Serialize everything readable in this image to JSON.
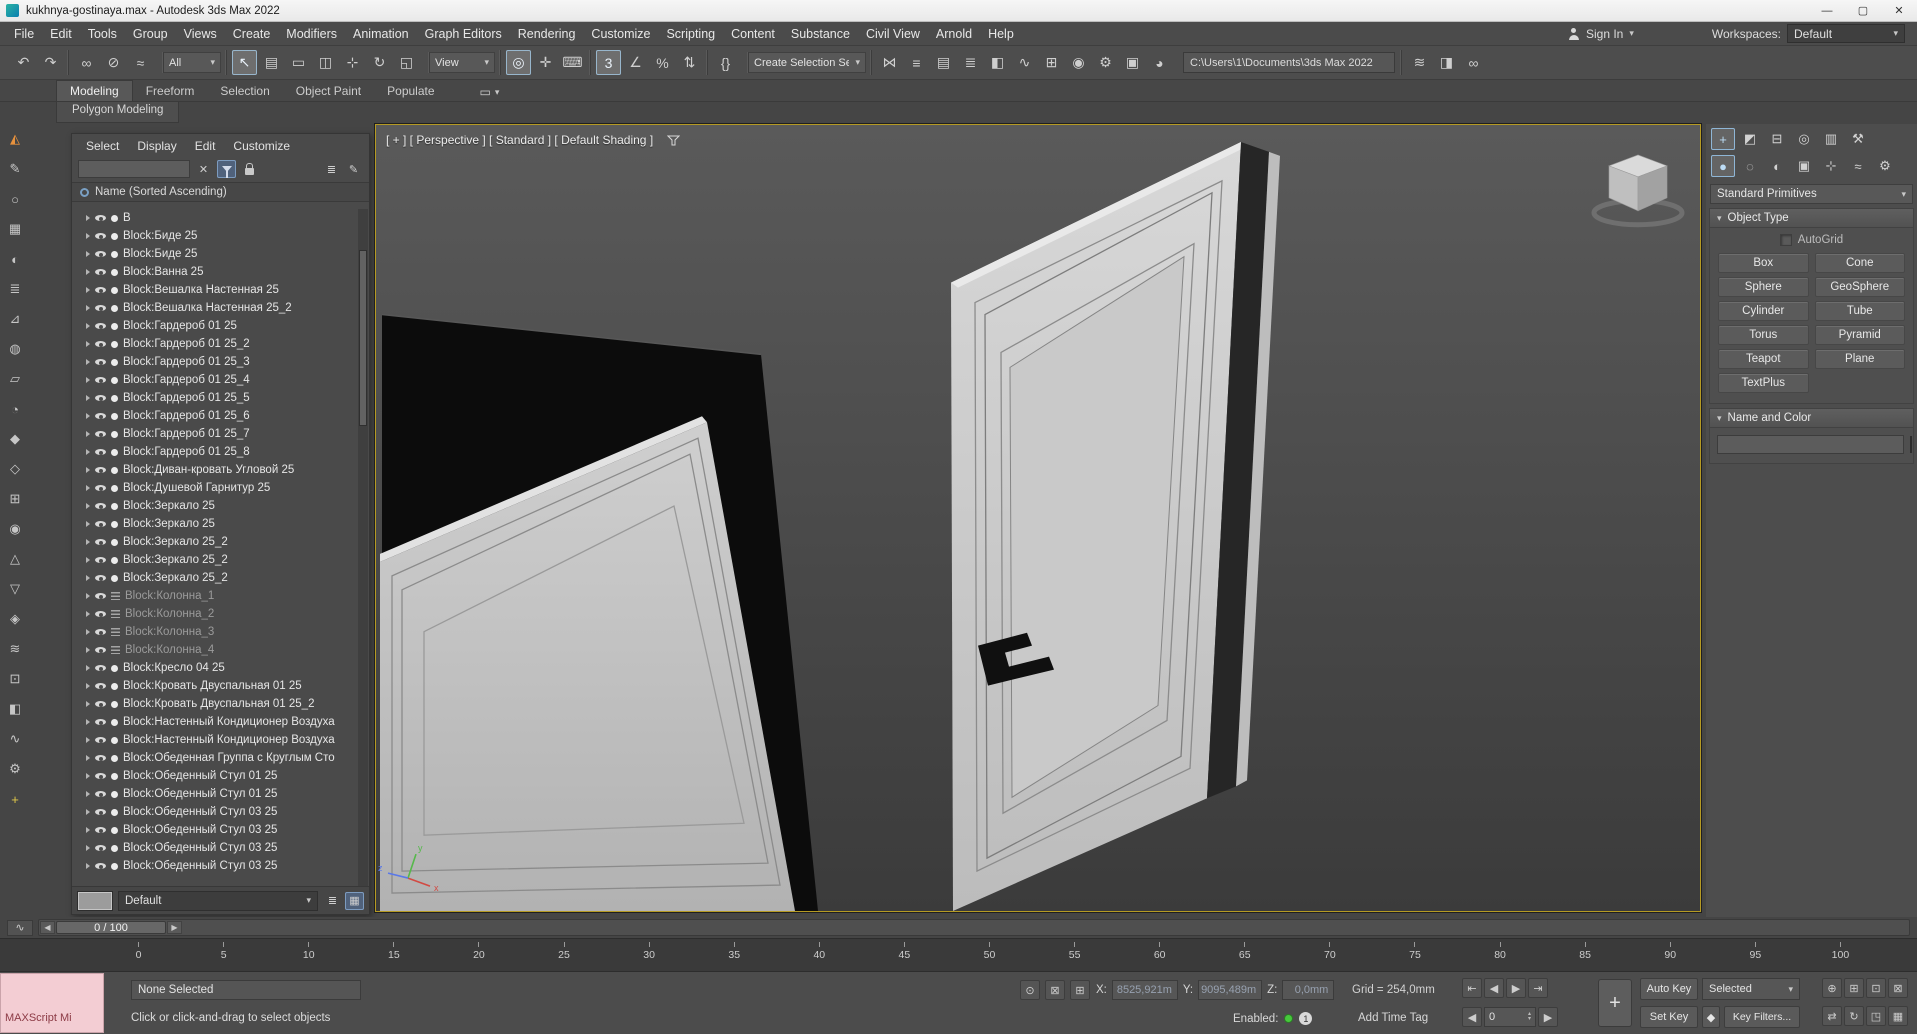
{
  "ui": {
    "caret": "▾",
    "rollout_arrow": "▾",
    "minimize": "—",
    "maximize": "▢",
    "close": "✕",
    "clear": "✕",
    "slider_left": "◀",
    "slider_right": "▶",
    "spinner_up": "▴",
    "spinner_down": "▾",
    "plus": "+",
    "mini_curve": "∿"
  },
  "title_bar": {
    "title": "kukhnya-gostinaya.max - Autodesk 3ds Max 2022"
  },
  "menu_bar": {
    "items": [
      "File",
      "Edit",
      "Tools",
      "Group",
      "Views",
      "Create",
      "Modifiers",
      "Animation",
      "Graph Editors",
      "Rendering",
      "Customize",
      "Scripting",
      "Content",
      "Substance",
      "Civil View",
      "Arnold",
      "Help"
    ],
    "sign_in": "Sign In",
    "workspaces_label": "Workspaces:",
    "workspace_value": "Default"
  },
  "toolbar": {
    "groups_a": [
      {
        "name": "undo-icon",
        "glyph": "↶"
      },
      {
        "name": "redo-icon",
        "glyph": "↷"
      }
    ],
    "groups_b": [
      {
        "name": "select-and-link-icon",
        "glyph": "∞"
      },
      {
        "name": "unlink-selection-icon",
        "glyph": "⊘"
      },
      {
        "name": "bind-to-space-warp-icon",
        "glyph": "≈"
      }
    ],
    "selection_filter_value": "All",
    "groups_c": [
      {
        "name": "select-object-icon",
        "glyph": "↖",
        "active": true
      },
      {
        "name": "select-by-name-icon",
        "glyph": "▤"
      },
      {
        "name": "rectangular-selection-icon",
        "glyph": "▭"
      },
      {
        "name": "crossing-selection-icon",
        "glyph": "◫"
      },
      {
        "name": "select-and-move-icon",
        "glyph": "⊹"
      },
      {
        "name": "select-and-rotate-icon",
        "glyph": "↻"
      },
      {
        "name": "select-and-scale-icon",
        "glyph": "◱"
      }
    ],
    "reference_coordinate_value": "View",
    "groups_d": [
      {
        "name": "use-pivot-point-icon",
        "glyph": "◎",
        "active": true
      },
      {
        "name": "select-and-manipulate-icon",
        "glyph": "✛"
      },
      {
        "name": "keyboard-override-icon",
        "glyph": "⌨"
      }
    ],
    "groups_e": [
      {
        "name": "snaps-toggle-icon",
        "glyph": "3",
        "active": true
      },
      {
        "name": "angle-snap-icon",
        "glyph": "∠"
      },
      {
        "name": "percent-snap-icon",
        "glyph": "%"
      },
      {
        "name": "spinner-snap-icon",
        "glyph": "⇅"
      }
    ],
    "groups_f": [
      {
        "name": "edit-named-selection-sets-icon",
        "glyph": "{}"
      }
    ],
    "named_selection_value": "Create Selection Se",
    "groups_g": [
      {
        "name": "mirror-icon",
        "glyph": "⋈"
      },
      {
        "name": "align-icon",
        "glyph": "≡"
      },
      {
        "name": "toggle-scene-explorer-icon",
        "glyph": "▤"
      },
      {
        "name": "toggle-layer-explorer-icon",
        "glyph": "≣"
      },
      {
        "name": "graphite-ribbon-icon",
        "glyph": "◧"
      },
      {
        "name": "curve-editor-icon",
        "glyph": "∿"
      },
      {
        "name": "schematic-view-icon",
        "glyph": "⊞"
      },
      {
        "name": "material-editor-icon",
        "glyph": "◉"
      },
      {
        "name": "render-setup-icon",
        "glyph": "⚙"
      },
      {
        "name": "rendered-frame-icon",
        "glyph": "▣"
      },
      {
        "name": "render-production-icon",
        "glyph": "◕"
      }
    ],
    "project_path": "C:\\Users\\1\\Documents\\3ds Max 2022",
    "groups_h": [
      {
        "name": "layer-explorer-icon",
        "glyph": "≋"
      },
      {
        "name": "container-explorer-icon",
        "glyph": "◨"
      },
      {
        "name": "manage-links-icon",
        "glyph": "∞"
      }
    ]
  },
  "ribbon": {
    "tabs": [
      {
        "label": "Modeling",
        "active": true
      },
      {
        "label": "Freeform"
      },
      {
        "label": "Selection"
      },
      {
        "label": "Object Paint"
      },
      {
        "label": "Populate"
      }
    ],
    "flyout_glyph": "▭",
    "panel_label": "Polygon Modeling"
  },
  "left_strip": {
    "icons": [
      {
        "name": "ribbon-modeling-icon",
        "glyph": "◭",
        "orange": true
      },
      {
        "name": "freeform-paint-icon",
        "glyph": "✎"
      },
      {
        "name": "spline-tool-icon",
        "glyph": "○"
      },
      {
        "name": "grid-tool-icon",
        "glyph": "▦"
      },
      {
        "name": "shading-tool-icon",
        "glyph": "◐"
      },
      {
        "name": "list-tool-icon",
        "glyph": "≣"
      },
      {
        "name": "cut-tool-icon",
        "glyph": "⊿"
      },
      {
        "name": "texture-tool-icon",
        "glyph": "◍"
      },
      {
        "name": "plane-tool-icon",
        "glyph": "▱"
      },
      {
        "name": "arc-tool-icon",
        "glyph": "◔"
      },
      {
        "name": "diamond-tool-icon",
        "glyph": "◆"
      },
      {
        "name": "outline-tool-icon",
        "glyph": "◇"
      },
      {
        "name": "boolean-tool-icon",
        "glyph": "⊞"
      },
      {
        "name": "sphere-tool-icon",
        "glyph": "◉"
      },
      {
        "name": "tri-up-tool-icon",
        "glyph": "△"
      },
      {
        "name": "tri-down-tool-icon",
        "glyph": "▽"
      },
      {
        "name": "gem-tool-icon",
        "glyph": "◈"
      },
      {
        "name": "waves-tool-icon",
        "glyph": "≋"
      },
      {
        "name": "target-tool-icon",
        "glyph": "⊡"
      },
      {
        "name": "half-square-tool-icon",
        "glyph": "◧"
      },
      {
        "name": "curve-tool-icon",
        "glyph": "∿"
      },
      {
        "name": "settings-tool-icon",
        "glyph": "⚙"
      },
      {
        "name": "add-tool-icon",
        "glyph": "+",
        "yellow": true
      }
    ]
  },
  "scene_explorer": {
    "menus": [
      "Select",
      "Display",
      "Edit",
      "Customize"
    ],
    "column_header": "Name (Sorted Ascending)",
    "tool_icons": [
      {
        "name": "pick-list-icon",
        "glyph": "≣"
      },
      {
        "name": "edit-columns-icon",
        "glyph": "✎"
      }
    ],
    "footer_icons": [
      {
        "name": "layers-icon",
        "glyph": "≣"
      },
      {
        "name": "grid-view-icon",
        "glyph": "▦",
        "active": true
      }
    ],
    "layer_value": "Default",
    "items": [
      {
        "label": "B"
      },
      {
        "label": "Block:Биде 25"
      },
      {
        "label": "Block:Биде 25"
      },
      {
        "label": "Block:Ванна 25"
      },
      {
        "label": "Block:Вешалка Настенная 25"
      },
      {
        "label": "Block:Вешалка Настенная 25_2"
      },
      {
        "label": "Block:Гардероб 01 25"
      },
      {
        "label": "Block:Гардероб 01 25_2"
      },
      {
        "label": "Block:Гардероб 01 25_3"
      },
      {
        "label": "Block:Гардероб 01 25_4"
      },
      {
        "label": "Block:Гардероб 01 25_5"
      },
      {
        "label": "Block:Гардероб 01 25_6"
      },
      {
        "label": "Block:Гардероб 01 25_7"
      },
      {
        "label": "Block:Гардероб 01 25_8"
      },
      {
        "label": "Block:Диван-кровать Угловой 25"
      },
      {
        "label": "Block:Душевой Гарнитур 25"
      },
      {
        "label": "Block:Зеркало 25"
      },
      {
        "label": "Block:Зеркало 25"
      },
      {
        "label": "Block:Зеркало 25_2"
      },
      {
        "label": "Block:Зеркало 25_2"
      },
      {
        "label": "Block:Зеркало 25_2"
      },
      {
        "label": "Block:Колонна_1",
        "dim": true
      },
      {
        "label": "Block:Колонна_2",
        "dim": true
      },
      {
        "label": "Block:Колонна_3",
        "dim": true
      },
      {
        "label": "Block:Колонна_4",
        "dim": true
      },
      {
        "label": "Block:Кресло 04 25"
      },
      {
        "label": "Block:Кровать Двуспальная 01 25"
      },
      {
        "label": "Block:Кровать Двуспальная 01 25_2"
      },
      {
        "label": "Block:Настенный Кондиционер Воздуха"
      },
      {
        "label": "Block:Настенный Кондиционер Воздуха"
      },
      {
        "label": "Block:Обеденная Группа с Круглым Сто"
      },
      {
        "label": "Block:Обеденный Стул 01 25"
      },
      {
        "label": "Block:Обеденный Стул 01 25"
      },
      {
        "label": "Block:Обеденный Стул 03 25"
      },
      {
        "label": "Block:Обеденный Стул 03 25"
      },
      {
        "label": "Block:Обеденный Стул 03 25"
      },
      {
        "label": "Block:Обеденный Стул 03 25"
      }
    ]
  },
  "viewport": {
    "label": "[ + ] [ Perspective ] [ Standard ] [ Default Shading ]",
    "axis": {
      "x": "x",
      "y": "y",
      "z": "z"
    }
  },
  "command_panel": {
    "tabs_top": [
      {
        "name": "create-tab-icon",
        "glyph": "+",
        "active": true
      },
      {
        "name": "modify-tab-icon",
        "glyph": "◩"
      },
      {
        "name": "hierarchy-tab-icon",
        "glyph": "⊟"
      },
      {
        "name": "motion-tab-icon",
        "glyph": "◎"
      },
      {
        "name": "display-tab-icon",
        "glyph": "▥"
      },
      {
        "name": "utilities-tab-icon",
        "glyph": "⚒"
      }
    ],
    "tabs_sub": [
      {
        "name": "geometry-category-icon",
        "glyph": "●",
        "active": true
      },
      {
        "name": "shapes-category-icon",
        "glyph": "◌"
      },
      {
        "name": "lights-category-icon",
        "glyph": "◐"
      },
      {
        "name": "cameras-category-icon",
        "glyph": "▣"
      },
      {
        "name": "helpers-category-icon",
        "glyph": "⊹"
      },
      {
        "name": "space-warps-category-icon",
        "glyph": "≈"
      },
      {
        "name": "systems-category-icon",
        "glyph": "⚙"
      }
    ],
    "category": "Standard Primitives",
    "object_type_title": "Object Type",
    "autogrid_label": "AutoGrid",
    "object_buttons": [
      "Box",
      "Cone",
      "Sphere",
      "GeoSphere",
      "Cylinder",
      "Tube",
      "Torus",
      "Pyramid",
      "Teapot",
      "Plane",
      "TextPlus"
    ],
    "name_color_title": "Name and Color",
    "object_color": "#e52cc4"
  },
  "timeline": {
    "slider_value": "0 / 100",
    "ticks": [
      "0",
      "5",
      "10",
      "15",
      "20",
      "25",
      "30",
      "35",
      "40",
      "45",
      "50",
      "55",
      "60",
      "65",
      "70",
      "75",
      "80",
      "85",
      "90",
      "95",
      "100"
    ]
  },
  "status_bar": {
    "maxscript_label": "MAXScript Mi",
    "selection_status": "None Selected",
    "prompt": "Click or click-and-drag to select objects",
    "mini_icons": [
      {
        "name": "isolate-selection-icon",
        "glyph": "⊙"
      },
      {
        "name": "selection-lock-icon",
        "glyph": "⊠"
      },
      {
        "name": "transform-gizmo-icon",
        "glyph": "⊞"
      }
    ],
    "x_label": "X:",
    "x_value": "8525,921m",
    "y_label": "Y:",
    "y_value": "9095,489m",
    "z_label": "Z:",
    "z_value": "0,0mm",
    "grid_label": "Grid = 254,0mm",
    "playback": [
      {
        "name": "go-to-start-button",
        "glyph": "⇤"
      },
      {
        "name": "previous-frame-button",
        "glyph": "◀"
      },
      {
        "name": "play-button",
        "glyph": "▶"
      },
      {
        "name": "go-to-end-button",
        "glyph": "⇥"
      }
    ],
    "frame_value": "0",
    "enabled_label": "Enabled:",
    "enabled_badge": "1",
    "add_time_tag": "Add Time Tag",
    "auto_key_label": "Auto Key",
    "selected_value": "Selected",
    "set_key_label": "Set Key",
    "key_mode_glyph": "◆",
    "key_filters_label": "Key Filters...",
    "nav_row1": [
      {
        "name": "zoom-icon",
        "glyph": "⊕"
      },
      {
        "name": "zoom-all-icon",
        "glyph": "⊞"
      },
      {
        "name": "zoom-extents-icon",
        "glyph": "⊡"
      },
      {
        "name": "zoom-region-icon",
        "glyph": "⊠"
      }
    ],
    "nav_row2": [
      {
        "name": "pan-view-icon",
        "glyph": "⇄"
      },
      {
        "name": "orbit-icon",
        "glyph": "↻"
      },
      {
        "name": "maximize-viewport-icon",
        "glyph": "◳"
      },
      {
        "name": "viewport-layout-icon",
        "glyph": "▦"
      }
    ]
  }
}
